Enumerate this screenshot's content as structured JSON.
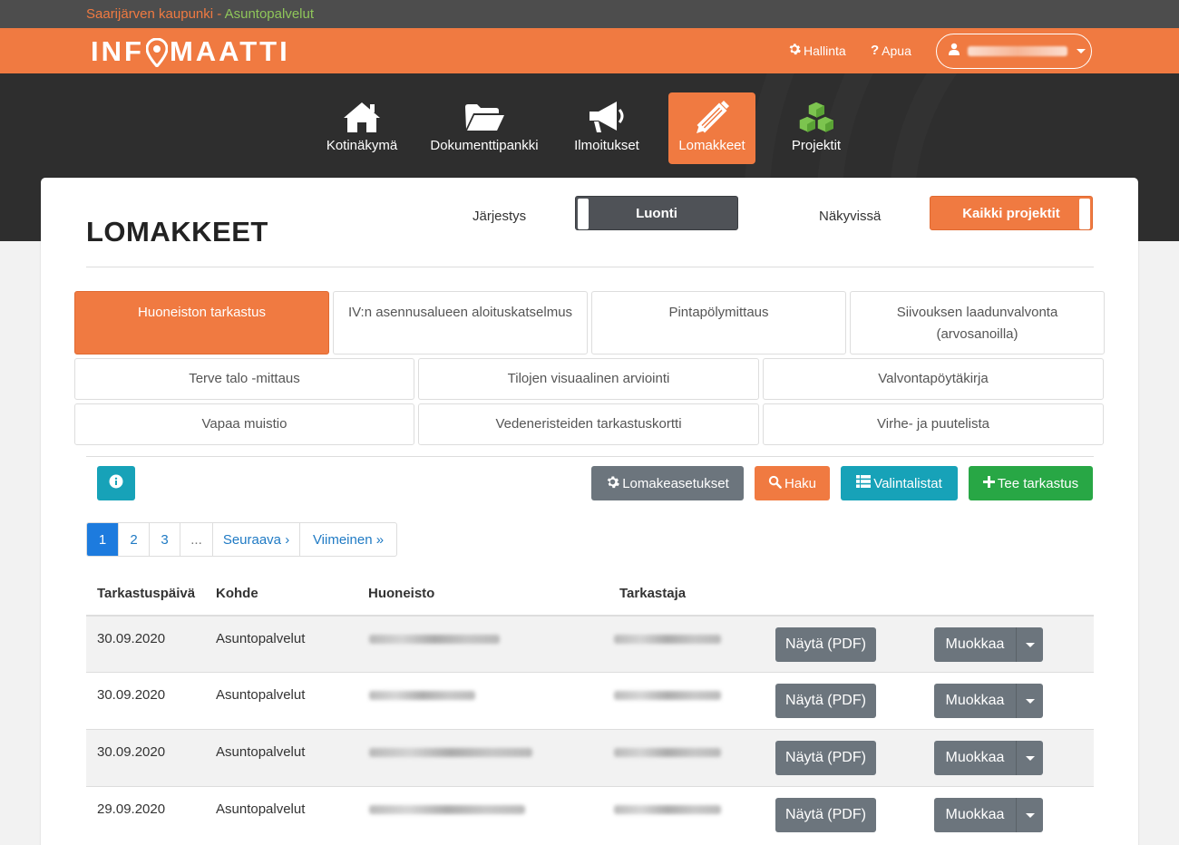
{
  "org": {
    "city": "Saarijärven kaupunki",
    "separator": " - ",
    "service": "Asuntopalvelut"
  },
  "header": {
    "logo_text_left": "INF",
    "logo_text_right": "MAATTI",
    "admin_label": "Hallinta",
    "help_label": "Apua"
  },
  "nav": {
    "items": [
      {
        "label": "Kotinäkymä",
        "icon": "home-icon"
      },
      {
        "label": "Dokumenttipankki",
        "icon": "folder-open-icon"
      },
      {
        "label": "Ilmoitukset",
        "icon": "megaphone-icon"
      },
      {
        "label": "Lomakkeet",
        "icon": "pencil-icon",
        "active": true
      },
      {
        "label": "Projektit",
        "icon": "cubes-icon"
      }
    ]
  },
  "page": {
    "title": "LOMAKKEET",
    "order_label": "Järjestys",
    "order_value": "Luonti",
    "visible_label": "Näkyvissä",
    "visible_value": "Kaikki projektit"
  },
  "form_tabs": [
    {
      "label": "Huoneiston tarkastus",
      "selected": true
    },
    {
      "label": "IV:n asennusalueen aloituskatselmus"
    },
    {
      "label": "Pintapölymittaus"
    },
    {
      "label": "Siivouksen laadunvalvonta (arvosanoilla)"
    },
    {
      "label": "Terve talo -mittaus"
    },
    {
      "label": "Tilojen visuaalinen arviointi"
    },
    {
      "label": "Valvontapöytäkirja"
    },
    {
      "label": "Vapaa muistio"
    },
    {
      "label": "Vedeneristeiden tarkastuskortti"
    },
    {
      "label": "Virhe- ja puutelista"
    }
  ],
  "toolbar": {
    "settings_label": "Lomakeasetukset",
    "search_label": "Haku",
    "lists_label": "Valintalistat",
    "create_label": "Tee tarkastus",
    "colors": {
      "info": "#17a2b8",
      "secondary": "#6c757d",
      "accent": "#f07a41",
      "success": "#28a745"
    }
  },
  "pagination": {
    "pages": [
      "1",
      "2",
      "3",
      "..."
    ],
    "next": "Seuraava ›",
    "last": "Viimeinen »",
    "current": 1
  },
  "table": {
    "columns": [
      "Tarkastuspäivä",
      "Kohde",
      "Huoneisto",
      "Tarkastaja"
    ],
    "view_label": "Näytä (PDF)",
    "edit_label": "Muokkaa",
    "rows": [
      {
        "date": "30.09.2020",
        "target": "Asuntopalvelut"
      },
      {
        "date": "30.09.2020",
        "target": "Asuntopalvelut"
      },
      {
        "date": "30.09.2020",
        "target": "Asuntopalvelut"
      },
      {
        "date": "29.09.2020",
        "target": "Asuntopalvelut"
      }
    ]
  }
}
